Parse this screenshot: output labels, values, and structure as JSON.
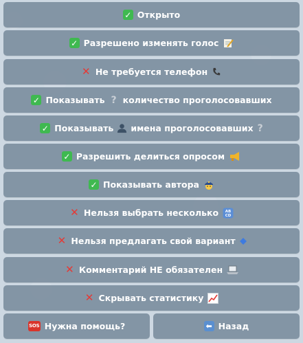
{
  "buttons": [
    {
      "status": "check",
      "label": "Открыто",
      "after": ""
    },
    {
      "status": "check",
      "label": "Разрешено изменять голос",
      "after": "memo-icon"
    },
    {
      "status": "cross",
      "label": "Не требуется телефон",
      "after": "telephone-icon"
    },
    {
      "status": "check",
      "label": "Показывать",
      "mid": "question-icon",
      "label2": "количество проголосовавших",
      "after": ""
    },
    {
      "status": "check",
      "label": "Показывать",
      "mid": "bust-icon",
      "label2": "имена проголосовавших",
      "after": "question-icon"
    },
    {
      "status": "check",
      "label": "Разрешить делиться опросом",
      "after": "megaphone-icon"
    },
    {
      "status": "check",
      "label": "Показывать автора",
      "after": "police-officer-icon"
    },
    {
      "status": "cross",
      "label": "Нельзя выбрать несколько",
      "after": "abcd-icon"
    },
    {
      "status": "cross",
      "label": "Нельзя предлагать свой вариант",
      "after": "diamond-icon"
    },
    {
      "status": "cross",
      "label": "Комментарий НЕ обязателен",
      "after": "laptop-icon"
    },
    {
      "status": "cross",
      "label": "Скрывать статистику",
      "after": "chart-increasing-icon"
    }
  ],
  "bottom": {
    "help_label": "Нужна помощь?",
    "help_icon_text": "SOS",
    "back_label": "Назад",
    "back_icon": "⬅"
  },
  "glyphs": {
    "check": "✓",
    "cross": "✕",
    "question": "?"
  }
}
